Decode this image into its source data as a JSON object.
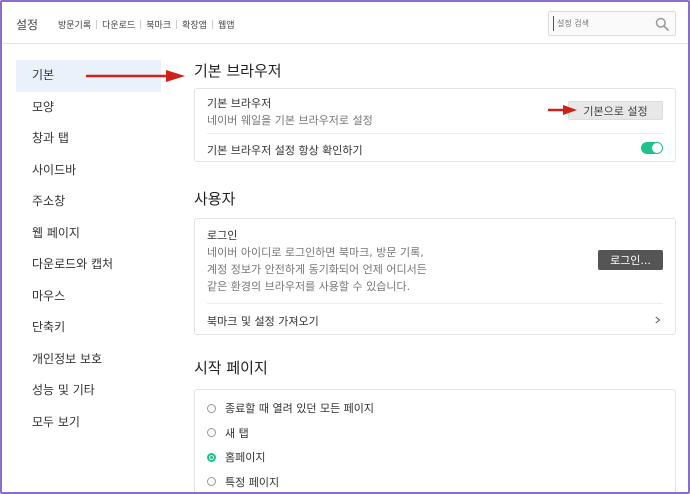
{
  "header": {
    "title": "설정",
    "nav": [
      "방문기록",
      "다운로드",
      "북마크",
      "확장앱",
      "웹앱"
    ],
    "search_placeholder": "설정 검색"
  },
  "sidebar": {
    "items": [
      {
        "label": "기본",
        "active": true
      },
      {
        "label": "모양"
      },
      {
        "label": "창과 탭"
      },
      {
        "label": "사이드바"
      },
      {
        "label": "주소창"
      },
      {
        "label": "웹 페이지"
      },
      {
        "label": "다운로드와 캡처"
      },
      {
        "label": "마우스"
      },
      {
        "label": "단축키"
      },
      {
        "label": "개인정보 보호"
      },
      {
        "label": "성능 및 기타"
      },
      {
        "label": "모두 보기"
      }
    ]
  },
  "default_browser": {
    "section_title": "기본 브라우저",
    "row_title": "기본 브라우저",
    "row_desc": "네이버 웨일을 기본 브라우저로 설정",
    "button_label": "기본으로 설정",
    "check_label": "기본 브라우저 설정 항상 확인하기",
    "check_enabled": true
  },
  "user": {
    "section_title": "사용자",
    "login_title": "로그인",
    "login_desc": [
      "네이버 아이디로 로그인하면 북마크, 방문 기록,",
      "계정 정보가 안전하게 동기화되어 언제 어디서든",
      "같은 환경의 브라우저를 사용할 수 있습니다."
    ],
    "login_button": "로그인...",
    "import_label": "북마크 및 설정 가져오기"
  },
  "start_page": {
    "section_title": "시작 페이지",
    "options": [
      {
        "label": "종료할 때 열려 있던 모든 페이지",
        "checked": false
      },
      {
        "label": "새 탭",
        "checked": false
      },
      {
        "label": "홈페이지",
        "checked": true
      },
      {
        "label": "특정 페이지",
        "checked": false
      }
    ]
  },
  "colors": {
    "accent": "#1ec28b",
    "arrow": "#d0201a",
    "active_bg": "#e9f2fb"
  }
}
